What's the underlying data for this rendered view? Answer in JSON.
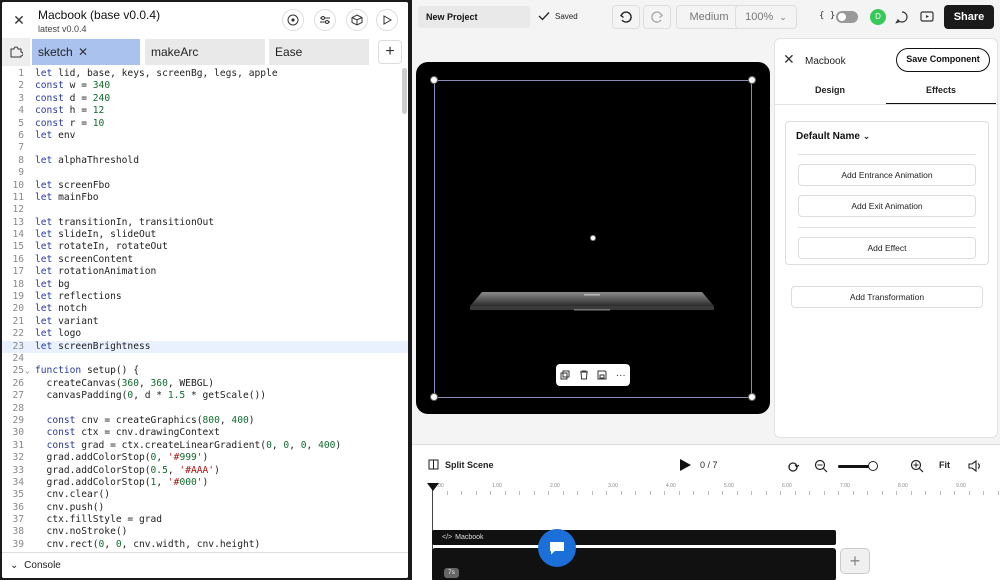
{
  "editor": {
    "title": "Macbook (base v0.0.4)",
    "subtitle": "latest v0.0.4",
    "tabs": [
      {
        "label": "sketch",
        "active": true
      },
      {
        "label": "makeArc",
        "active": false
      },
      {
        "label": "Ease",
        "active": false
      }
    ],
    "console_label": "Console",
    "highlighted_line": 23,
    "lines": [
      {
        "n": "1",
        "code": "let lid, base, keys, screenBg, legs, apple"
      },
      {
        "n": "2",
        "code": "const w = 340"
      },
      {
        "n": "3",
        "code": "const d = 240"
      },
      {
        "n": "4",
        "code": "const h = 12"
      },
      {
        "n": "5",
        "code": "const r = 10"
      },
      {
        "n": "6",
        "code": "let env"
      },
      {
        "n": "7",
        "code": ""
      },
      {
        "n": "8",
        "code": "let alphaThreshold"
      },
      {
        "n": "9",
        "code": ""
      },
      {
        "n": "10",
        "code": "let screenFbo"
      },
      {
        "n": "11",
        "code": "let mainFbo"
      },
      {
        "n": "12",
        "code": ""
      },
      {
        "n": "13",
        "code": "let transitionIn, transitionOut"
      },
      {
        "n": "14",
        "code": "let slideIn, slideOut"
      },
      {
        "n": "15",
        "code": "let rotateIn, rotateOut"
      },
      {
        "n": "16",
        "code": "let screenContent"
      },
      {
        "n": "17",
        "code": "let rotationAnimation"
      },
      {
        "n": "18",
        "code": "let bg"
      },
      {
        "n": "19",
        "code": "let reflections"
      },
      {
        "n": "20",
        "code": "let notch"
      },
      {
        "n": "21",
        "code": "let variant"
      },
      {
        "n": "22",
        "code": "let logo"
      },
      {
        "n": "23",
        "code": "let screenBrightness"
      },
      {
        "n": "24",
        "code": ""
      },
      {
        "n": "25",
        "code": "function setup() {"
      },
      {
        "n": "26",
        "code": "  createCanvas(360, 360, WEBGL)"
      },
      {
        "n": "27",
        "code": "  canvasPadding(0, d * 1.5 * getScale())"
      },
      {
        "n": "28",
        "code": ""
      },
      {
        "n": "29",
        "code": "  const cnv = createGraphics(800, 400)"
      },
      {
        "n": "30",
        "code": "  const ctx = cnv.drawingContext"
      },
      {
        "n": "31",
        "code": "  const grad = ctx.createLinearGradient(0, 0, 0, 400)"
      },
      {
        "n": "32",
        "code": "  grad.addColorStop(0, '#999')"
      },
      {
        "n": "33",
        "code": "  grad.addColorStop(0.5, '#AAA')"
      },
      {
        "n": "34",
        "code": "  grad.addColorStop(1, '#000')"
      },
      {
        "n": "35",
        "code": "  cnv.clear()"
      },
      {
        "n": "36",
        "code": "  cnv.push()"
      },
      {
        "n": "37",
        "code": "  ctx.fillStyle = grad"
      },
      {
        "n": "38",
        "code": "  cnv.noStroke()"
      },
      {
        "n": "39",
        "code": "  cnv.rect(0, 0, cnv.width, cnv.height)"
      }
    ]
  },
  "topbar": {
    "project_name": "New Project",
    "saved_label": "Saved",
    "quality": "Medium",
    "zoom": "100%",
    "code_toggle": "{ }",
    "avatar_letter": "D",
    "share_label": "Share"
  },
  "panel": {
    "title": "Macbook",
    "save_component": "Save Component",
    "tabs": [
      {
        "label": "Design",
        "active": false
      },
      {
        "label": "Effects",
        "active": true
      }
    ],
    "effect_group": "Default Name",
    "add_entrance": "Add Entrance Animation",
    "add_exit": "Add Exit Animation",
    "add_effect": "Add Effect",
    "add_transformation": "Add Transformation"
  },
  "timeline": {
    "split_scene": "Split Scene",
    "counter": "0 / 7",
    "fit_label": "Fit",
    "ruler": [
      "0.00",
      "1.00",
      "2.00",
      "3.00",
      "4.00",
      "5.00",
      "6.00",
      "7.00",
      "8.00",
      "9.00"
    ],
    "track_label": "Macbook",
    "duration_badge": "7s"
  },
  "colors": {
    "tab_active": "#a9c2ee",
    "keyword": "#2a3b9e",
    "number": "#116b2f",
    "string": "#a11",
    "avatar": "#38c95b",
    "chat": "#1a6fd9"
  }
}
